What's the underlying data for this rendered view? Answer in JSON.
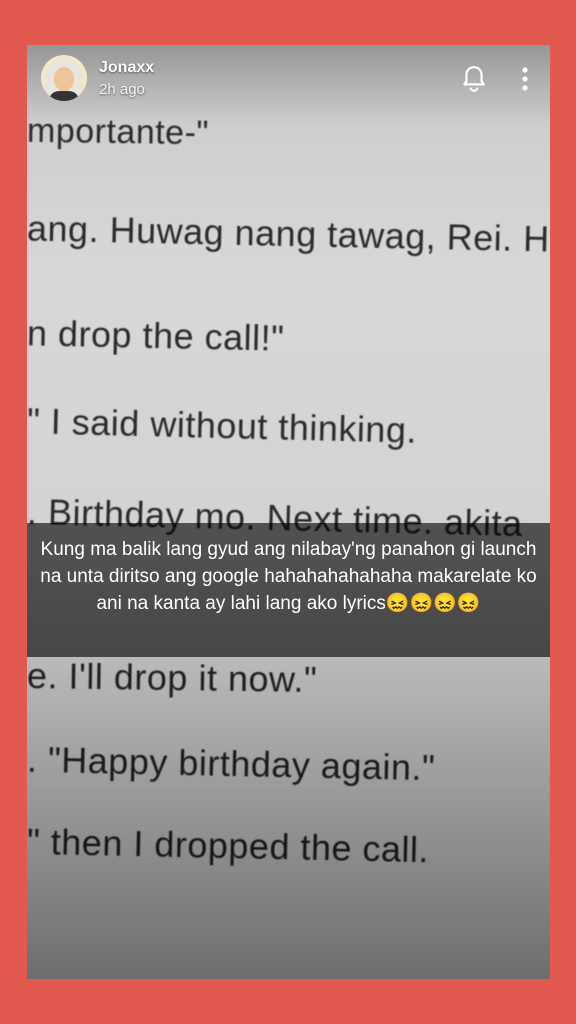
{
  "header": {
    "username": "Jonaxx",
    "timestamp": "2h ago",
    "icons": [
      "bell-icon",
      "more-vertical-icon"
    ]
  },
  "photo_text": [
    "mportante-\"",
    "ang. Huwag nang tawag, Rei. H",
    "n drop the call!\"",
    "\" I said without thinking.",
    ". Birthday mo. Next time. akita",
    "e. I'll drop it now.\"",
    ". \"Happy birthday again.\"",
    "\" then I dropped the call."
  ],
  "caption": "Kung ma balik lang gyud ang nilabay'ng panahon gi launch na unta diritso ang google hahahahahahaha makarelate ko ani na kanta ay lahi lang ako lyrics😖😖😖😖",
  "colors": {
    "frame": "#e25a4f",
    "caption_bg": "rgba(0,0,0,0.62)"
  }
}
